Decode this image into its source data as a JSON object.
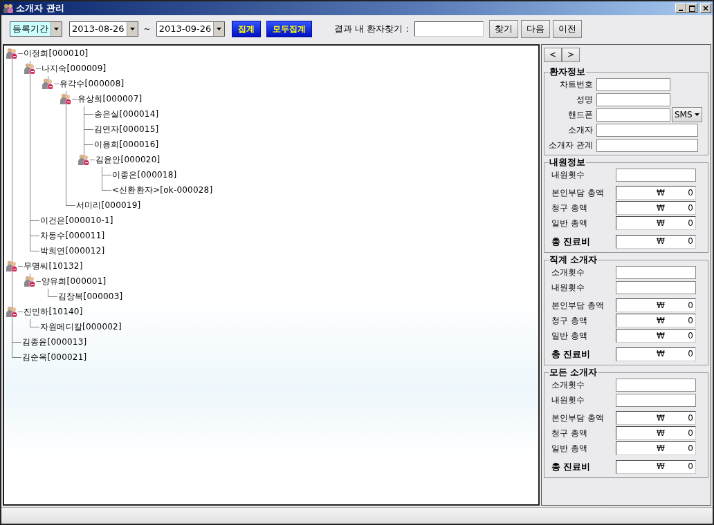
{
  "window": {
    "title": "소개자 관리"
  },
  "toolbar": {
    "period": "등록기간",
    "date_from": "2013-08-26",
    "range_sep": "~",
    "date_to": "2013-09-26",
    "sum_buttons": [
      "집계",
      "모두집계"
    ],
    "search_label": "결과 내 환자찾기 :",
    "search_buttons": [
      "찾기",
      "다음",
      "이전"
    ]
  },
  "tree": [
    {
      "label": "이정희[000010]",
      "children": [
        {
          "label": "나지숙[000009]",
          "children": [
            {
              "label": "유각수[000008]",
              "children": [
                {
                  "label": "유상희[000007]",
                  "children": [
                    {
                      "label": "송은실[000014]"
                    },
                    {
                      "label": "김연자[000015]"
                    },
                    {
                      "label": "이용희[000016]"
                    },
                    {
                      "label": "김윤안[000020]",
                      "children": [
                        {
                          "label": "이종은[000018]"
                        },
                        {
                          "label": "<신환환자>[ok-000028]"
                        }
                      ]
                    }
                  ]
                },
                {
                  "label": "서미리[000019]"
                }
              ]
            }
          ]
        },
        {
          "label": "이건은[000010-1]"
        },
        {
          "label": "차동수[000011]"
        },
        {
          "label": "박희연[000012]"
        }
      ]
    },
    {
      "label": "무명씨[10132]",
      "children": [
        {
          "label": "양유희[000001]",
          "children": [
            {
              "label": "김장복[000003]"
            }
          ]
        }
      ]
    },
    {
      "label": "진민하[10140]",
      "children": [
        {
          "label": "자원메디칼[000002]"
        }
      ]
    },
    {
      "label": "김종윤[000013]"
    },
    {
      "label": "김순옥[000021]"
    }
  ],
  "side": {
    "nav_buttons": [
      "<",
      ">"
    ],
    "groups": [
      {
        "title": "환자정보",
        "fields": [
          {
            "label": "차트번호",
            "kind": "short"
          },
          {
            "label": "성명",
            "kind": "short"
          },
          {
            "label": "핸드폰",
            "kind": "phone",
            "button": "SMS"
          },
          {
            "label": "소개자",
            "kind": "text"
          },
          {
            "label": "소개자 관계",
            "kind": "text"
          }
        ]
      },
      {
        "title": "내원정보",
        "fields": [
          {
            "label": "내원횟수",
            "kind": "text"
          },
          {
            "label": "본인부담 총액",
            "kind": "money",
            "currency": "₩",
            "value": "0"
          },
          {
            "label": "청구 총액",
            "kind": "money",
            "currency": "₩",
            "value": "0"
          },
          {
            "label": "일반 총액",
            "kind": "money",
            "currency": "₩",
            "value": "0"
          },
          {
            "label": "총 진료비",
            "kind": "total",
            "currency": "₩",
            "value": "0"
          }
        ]
      },
      {
        "title": "직계 소개자",
        "fields": [
          {
            "label": "소개횟수",
            "kind": "text"
          },
          {
            "label": "내원횟수",
            "kind": "text"
          },
          {
            "label": "본인부담 총액",
            "kind": "money",
            "currency": "₩",
            "value": "0"
          },
          {
            "label": "청구 총액",
            "kind": "money",
            "currency": "₩",
            "value": "0"
          },
          {
            "label": "일반 총액",
            "kind": "money",
            "currency": "₩",
            "value": "0"
          },
          {
            "label": "총 진료비",
            "kind": "total",
            "currency": "₩",
            "value": "0"
          }
        ]
      },
      {
        "title": "모든 소개자",
        "fields": [
          {
            "label": "소개횟수",
            "kind": "text"
          },
          {
            "label": "내원횟수",
            "kind": "text"
          },
          {
            "label": "본인부담 총액",
            "kind": "money",
            "currency": "₩",
            "value": "0"
          },
          {
            "label": "청구 총액",
            "kind": "money",
            "currency": "₩",
            "value": "0"
          },
          {
            "label": "일반 총액",
            "kind": "money",
            "currency": "₩",
            "value": "0"
          },
          {
            "label": "총 진료비",
            "kind": "total",
            "currency": "₩",
            "value": "0"
          }
        ]
      }
    ]
  }
}
